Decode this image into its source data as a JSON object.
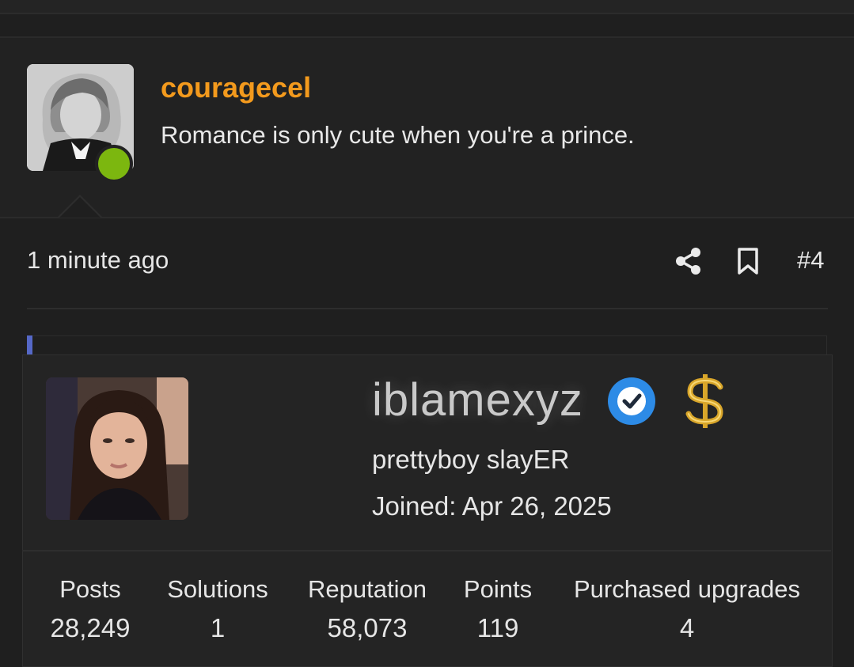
{
  "post": {
    "username": "couragecel",
    "message": "Romance is only cute when you're a prince.",
    "time": "1 minute ago",
    "post_number": "#4",
    "status_color": "#7cb70f",
    "username_color": "#f39a1d"
  },
  "icons": {
    "share": "share-icon",
    "bookmark": "bookmark-icon",
    "verified": "verified-badge-icon",
    "dollar": "dollar-icon"
  },
  "profile_card": {
    "username": "iblamexyz",
    "user_title": "prettyboy slayER",
    "joined": "Joined: Apr 26, 2025",
    "verified_color": "#2d8be6",
    "stats": [
      {
        "label": "Posts",
        "value": "28,249"
      },
      {
        "label": "Solutions",
        "value": "1"
      },
      {
        "label": "Reputation",
        "value": "58,073"
      },
      {
        "label": "Points",
        "value": "119"
      },
      {
        "label": "Purchased upgrades",
        "value": "4"
      }
    ]
  }
}
